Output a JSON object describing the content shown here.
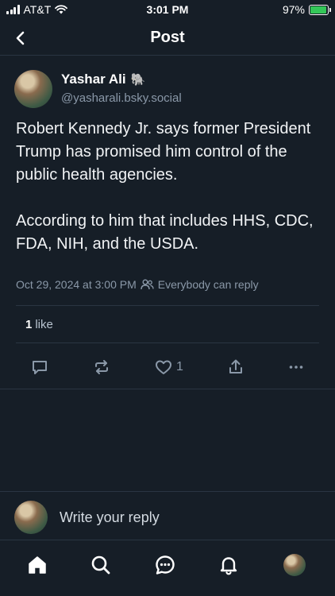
{
  "status_bar": {
    "carrier": "AT&T",
    "time": "3:01 PM",
    "battery_percent": "97%",
    "battery_level": 0.97
  },
  "header": {
    "title": "Post"
  },
  "post": {
    "author_name": "Yashar Ali",
    "author_emoji": "🐘",
    "author_handle": "@yasharali.bsky.social",
    "text": "Robert Kennedy Jr. says former President Trump has promised him control of the public health agencies.\n\nAccording to him that includes HHS, CDC, FDA, NIH, and the USDA.",
    "timestamp": "Oct 29, 2024 at 3:00 PM",
    "reply_setting": "Everybody can reply",
    "likes_count": "1",
    "likes_label": "like",
    "like_action_count": "1"
  },
  "reply_bar": {
    "placeholder": "Write your reply"
  },
  "icons": {
    "back": "chevron-left-icon",
    "reply": "comment-icon",
    "repost": "repost-icon",
    "like": "heart-icon",
    "share": "share-icon",
    "more": "ellipsis-icon",
    "home": "home-icon",
    "search": "search-icon",
    "chat": "chat-icon",
    "notifications": "bell-icon"
  },
  "colors": {
    "background": "#161e27",
    "divider": "#2a3542",
    "muted_text": "#8a98a8",
    "battery": "#34c759"
  }
}
